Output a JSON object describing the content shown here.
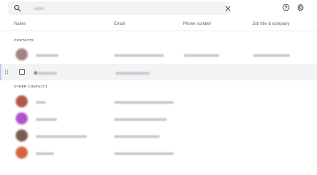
{
  "search": {
    "placeholder": "Search",
    "query_blurred": true
  },
  "toolbar": {
    "icons": [
      "search-icon",
      "close-icon",
      "help-icon",
      "gear-icon"
    ]
  },
  "columns": {
    "name": "Name",
    "email": "Email",
    "phone": "Phone number",
    "job": "Job title & company"
  },
  "sections": {
    "contacts": "CONTACTS",
    "other_contacts": "OTHER CONTACTS"
  },
  "contacts": [
    {
      "avatar_color": "#a0847e",
      "name_blurred": true,
      "email_blurred": true,
      "phone_blurred": true,
      "job_blurred": true
    },
    {
      "avatar_color": null,
      "selected": true,
      "name_blurred": true,
      "email_blurred": true
    }
  ],
  "other_contacts": [
    {
      "avatar_color": "#b05a4c",
      "name_blurred": true,
      "email_blurred": true
    },
    {
      "avatar_color": "#b452c9",
      "name_blurred": true,
      "email_blurred": true
    },
    {
      "avatar_color": "#7c5a54",
      "name_blurred": true,
      "email_blurred": true
    },
    {
      "avatar_color": "#d8643e",
      "name_blurred": true,
      "email_blurred": true
    }
  ],
  "colors": {
    "selected_row": "#f1f3f4",
    "search_bg": "#f1f3f4",
    "blur_text": "#c9ccd0"
  }
}
